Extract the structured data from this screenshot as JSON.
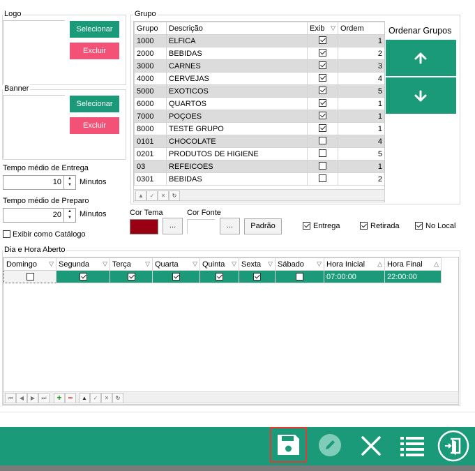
{
  "logo": {
    "legend": "Logo",
    "select_label": "Selecionar",
    "delete_label": "Excluir"
  },
  "banner": {
    "legend": "Banner",
    "select_label": "Selecionar",
    "delete_label": "Excluir"
  },
  "delivery_time": {
    "label": "Tempo médio de Entrega",
    "value": "10",
    "unit": "Minutos"
  },
  "prep_time": {
    "label": "Tempo médio de Preparo",
    "value": "20",
    "unit": "Minutos"
  },
  "catalog": {
    "label": "Exibir como Catálogo",
    "checked": false
  },
  "group": {
    "legend": "Grupo",
    "columns": [
      "Grupo",
      "Descrição",
      "Exib",
      "Ordem"
    ],
    "rows": [
      {
        "code": "1000",
        "desc": "ELFICA",
        "show": true,
        "order": "1"
      },
      {
        "code": "2000",
        "desc": "BEBIDAS",
        "show": true,
        "order": "2"
      },
      {
        "code": "3000",
        "desc": "CARNES",
        "show": true,
        "order": "3"
      },
      {
        "code": "4000",
        "desc": "CERVEJAS",
        "show": true,
        "order": "4"
      },
      {
        "code": "5000",
        "desc": "EXOTICOS",
        "show": true,
        "order": "5"
      },
      {
        "code": "6000",
        "desc": "QUARTOS",
        "show": true,
        "order": "1"
      },
      {
        "code": "7000",
        "desc": "POÇOES",
        "show": true,
        "order": "1"
      },
      {
        "code": "8000",
        "desc": "TESTE GRUPO",
        "show": true,
        "order": "1"
      },
      {
        "code": "0101",
        "desc": "CHOCOLATE",
        "show": false,
        "order": "4"
      },
      {
        "code": "0201",
        "desc": "PRODUTOS DE HIGIENE",
        "show": false,
        "order": "5"
      },
      {
        "code": "03",
        "desc": "REFEICOES",
        "show": false,
        "order": "1"
      },
      {
        "code": "0301",
        "desc": "BEBIDAS",
        "show": false,
        "order": "2"
      }
    ],
    "order_title": "Ordenar Grupos"
  },
  "theme": {
    "color_label": "Cor Tema",
    "font_label": "Cor Fonte",
    "browse": "...",
    "default_label": "Padrão",
    "theme_color": "#990011"
  },
  "options": {
    "delivery": "Entrega",
    "pickup": "Retirada",
    "local": "No Local"
  },
  "schedule": {
    "legend": "Dia e Hora Aberto",
    "columns": [
      "Domingo",
      "Segunda",
      "Terça",
      "Quarta",
      "Quinta",
      "Sexta",
      "Sábado",
      "Hora Inicial",
      "Hora Final"
    ],
    "row": {
      "days": [
        false,
        true,
        true,
        true,
        true,
        true,
        false
      ],
      "start": "07:00:00",
      "end": "22:00:00"
    }
  },
  "colors": {
    "accent": "#1a9a78",
    "danger": "#f45177",
    "highlight": "#e53935"
  }
}
